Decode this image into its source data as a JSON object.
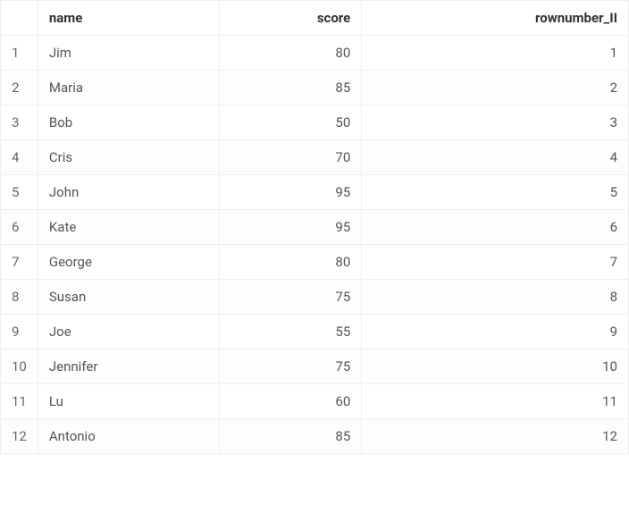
{
  "table": {
    "headers": {
      "index": "",
      "name": "name",
      "score": "score",
      "rownumber": "rownumber_II"
    },
    "rows": [
      {
        "index": "1",
        "name": "Jim",
        "score": "80",
        "rownumber": "1"
      },
      {
        "index": "2",
        "name": "Maria",
        "score": "85",
        "rownumber": "2"
      },
      {
        "index": "3",
        "name": "Bob",
        "score": "50",
        "rownumber": "3"
      },
      {
        "index": "4",
        "name": "Cris",
        "score": "70",
        "rownumber": "4"
      },
      {
        "index": "5",
        "name": "John",
        "score": "95",
        "rownumber": "5"
      },
      {
        "index": "6",
        "name": "Kate",
        "score": "95",
        "rownumber": "6"
      },
      {
        "index": "7",
        "name": "George",
        "score": "80",
        "rownumber": "7"
      },
      {
        "index": "8",
        "name": "Susan",
        "score": "75",
        "rownumber": "8"
      },
      {
        "index": "9",
        "name": "Joe",
        "score": "55",
        "rownumber": "9"
      },
      {
        "index": "10",
        "name": "Jennifer",
        "score": "75",
        "rownumber": "10"
      },
      {
        "index": "11",
        "name": "Lu",
        "score": "60",
        "rownumber": "11"
      },
      {
        "index": "12",
        "name": "Antonio",
        "score": "85",
        "rownumber": "12"
      }
    ]
  }
}
